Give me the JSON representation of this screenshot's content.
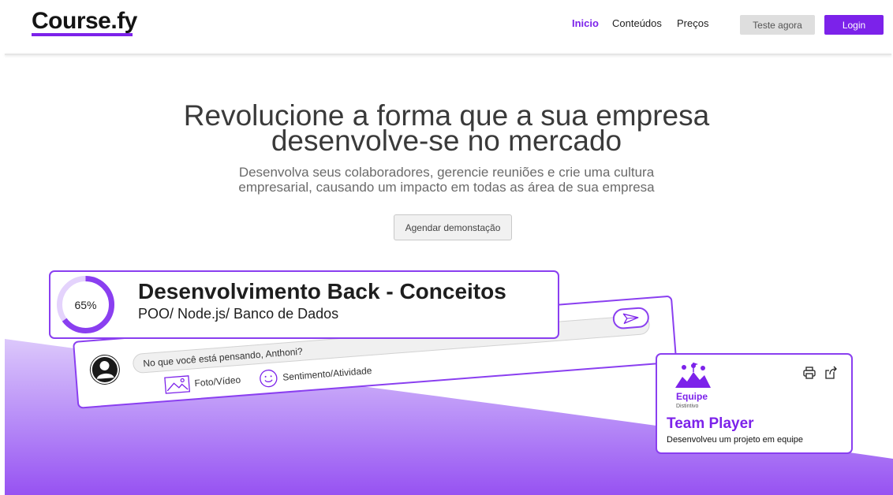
{
  "header": {
    "logo": "Course.fy",
    "nav": [
      "Inicio",
      "Conteúdos",
      "Preços"
    ],
    "active_nav": "Inicio",
    "test_button": "Teste agora",
    "login_button": "Login"
  },
  "hero": {
    "title_line1": "Revolucione a forma que a sua empresa",
    "title_line2": "desenvolve-se no mercado",
    "subtitle_line1": "Desenvolva seus colaboradores, gerencie reuniões e crie uma cultura",
    "subtitle_line2": "empresarial, causando um impacto em todas as área de sua empresa",
    "demo_button": "Agendar demonstação"
  },
  "course_card": {
    "progress_label": "65%",
    "progress_value": 0.65,
    "title": "Desenvolvimento Back - Conceitos",
    "subtitle": "POO/ Node.js/ Banco de Dados"
  },
  "post_card": {
    "avatar_icon": "user-icon",
    "input_placeholder": "No que você está pensando, Anthoni?",
    "send_icon": "send-icon",
    "actions": [
      {
        "icon": "image-icon",
        "label": "Foto/Vídeo"
      },
      {
        "icon": "smile-icon",
        "label": "Sentimento/Atividade"
      }
    ]
  },
  "badge_card": {
    "logo_label": "Equipe",
    "logo_sub": "Distintivo",
    "title": "Team Player",
    "description": "Desenvolveu um projeto em equipe",
    "icons": [
      "print-icon",
      "share-icon"
    ]
  },
  "colors": {
    "accent": "#7c22ea",
    "border": "#8a3ff0",
    "wave_light": "#d8c2fa",
    "wave_dark": "#9a55f3"
  }
}
